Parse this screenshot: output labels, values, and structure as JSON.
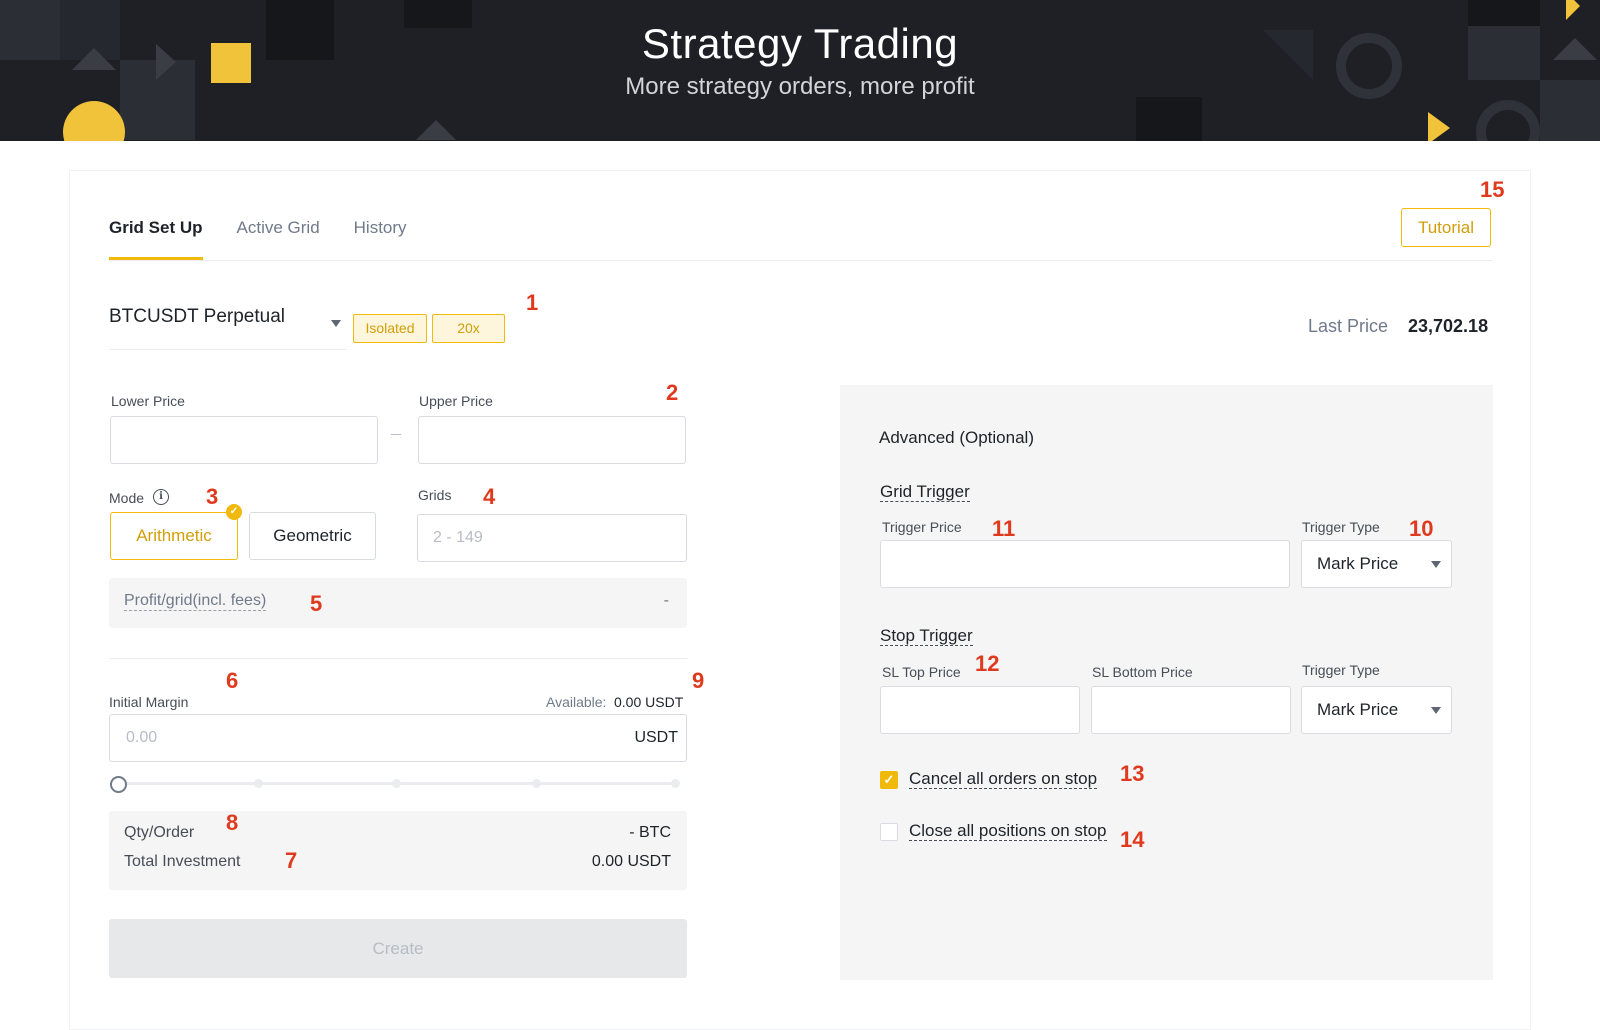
{
  "hero": {
    "title": "Strategy Trading",
    "subtitle": "More strategy orders, more profit"
  },
  "tabs": [
    "Grid Set Up",
    "Active Grid",
    "History"
  ],
  "active_tab": "Grid Set Up",
  "tutorial_label": "Tutorial",
  "symbol": {
    "name": "BTCUSDT Perpetual",
    "margin_mode": "Isolated",
    "leverage": "20x"
  },
  "last_price": {
    "label": "Last Price",
    "value": "23,702.18"
  },
  "form": {
    "lower_price_label": "Lower Price",
    "upper_price_label": "Upper Price",
    "mode_label": "Mode",
    "mode_options": [
      "Arithmetic",
      "Geometric"
    ],
    "mode_selected": "Arithmetic",
    "grids_label": "Grids",
    "grids_placeholder": "2 - 149",
    "profit_label": "Profit/grid(incl. fees)",
    "profit_value": "-",
    "initial_margin_label": "Initial Margin",
    "available_label": "Available:",
    "available_value": "0.00 USDT",
    "margin_placeholder": "0.00",
    "margin_unit": "USDT",
    "slider_value_percent": 0,
    "qty_label": "Qty/Order",
    "qty_value": "- BTC",
    "total_label": "Total Investment",
    "total_value": "0.00 USDT",
    "create_label": "Create"
  },
  "advanced": {
    "title": "Advanced (Optional)",
    "grid_trigger_title": "Grid Trigger",
    "trigger_price_label": "Trigger Price",
    "trigger_type_label": "Trigger Type",
    "trigger_type_value": "Mark Price",
    "stop_trigger_title": "Stop Trigger",
    "sl_top_label": "SL Top Price",
    "sl_bottom_label": "SL Bottom Price",
    "stop_trigger_type_label": "Trigger Type",
    "stop_trigger_type_value": "Mark Price",
    "cancel_orders_label": "Cancel all orders on stop",
    "cancel_orders_checked": true,
    "close_positions_label": "Close all positions on stop",
    "close_positions_checked": false
  },
  "callouts": [
    "1",
    "2",
    "3",
    "4",
    "5",
    "6",
    "7",
    "8",
    "9",
    "10",
    "11",
    "12",
    "13",
    "14",
    "15"
  ],
  "colors": {
    "accent": "#f0b90b",
    "callout": "#e03a1e",
    "hero_bg": "#1e2026"
  }
}
